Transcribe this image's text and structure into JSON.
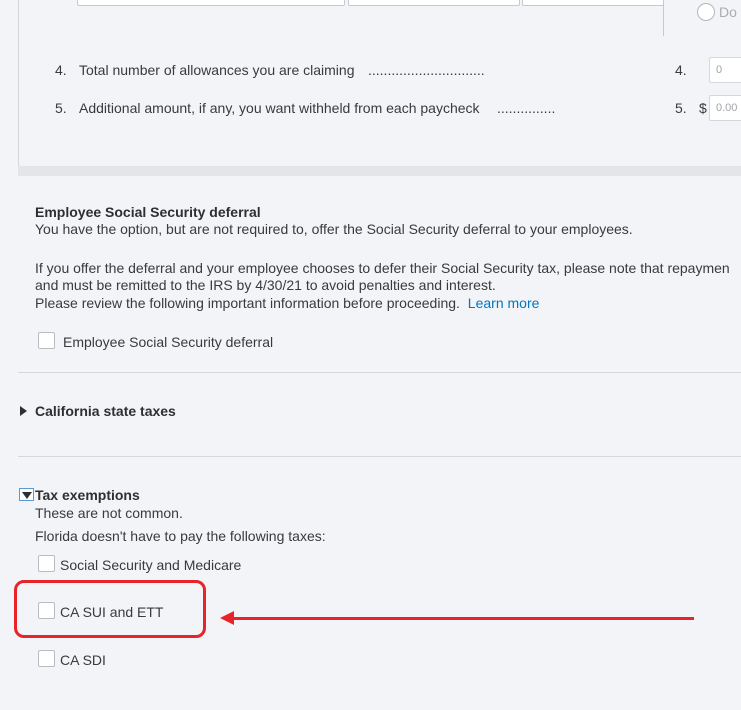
{
  "withholding": {
    "radio_label": "Do",
    "rows": [
      {
        "num": "4.",
        "label": "Total number of allowances you are claiming",
        "dots": "..............................",
        "ref": "4.",
        "currency": "",
        "value": "0"
      },
      {
        "num": "5.",
        "label": "Additional amount, if any, you want withheld from each paycheck",
        "dots": "...............",
        "ref": "5.",
        "currency": "$",
        "value": "0.00"
      }
    ]
  },
  "ss_deferral": {
    "title": "Employee Social Security deferral",
    "line1": "You have the option, but are not required to, offer the Social Security deferral to your employees.",
    "line2": "If you offer the deferral and your employee chooses to defer their Social Security tax, please note that repaymen",
    "line3": "and must be remitted to the IRS by 4/30/21 to avoid penalties and interest.",
    "line4": "Please review the following important information before proceeding.",
    "learn_more": "Learn more",
    "checkbox_label": "Employee Social Security deferral"
  },
  "california": {
    "title": "California state taxes"
  },
  "exemptions": {
    "title": "Tax exemptions",
    "note1": "These are not common.",
    "note2": "Florida doesn't have to pay the following taxes:",
    "items": [
      {
        "label": "Social Security and Medicare"
      },
      {
        "label": "CA SUI and ETT"
      },
      {
        "label": "CA SDI"
      }
    ]
  },
  "colors": {
    "highlight": "#e8232a",
    "link": "#0077c5"
  }
}
